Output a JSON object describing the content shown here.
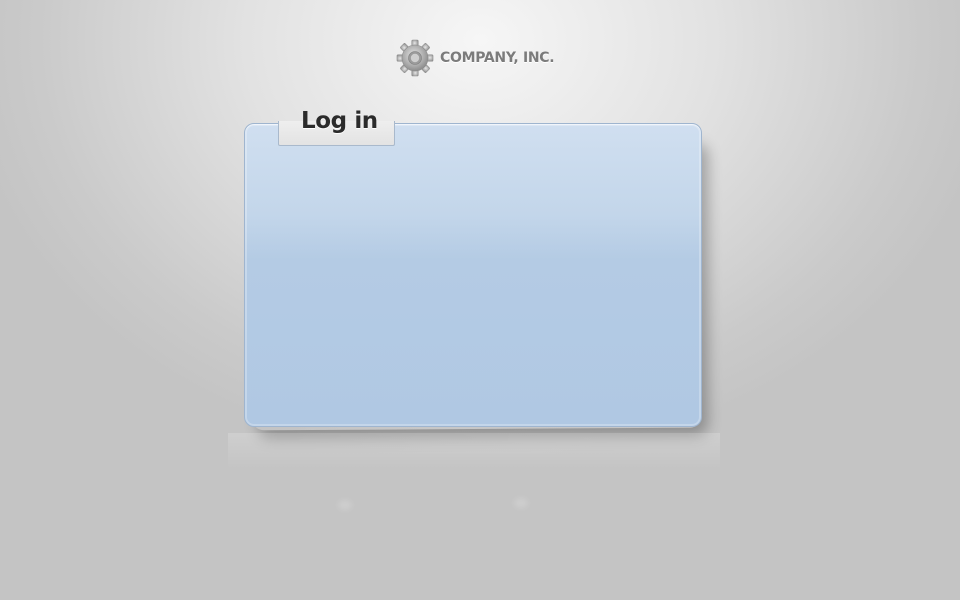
{
  "logo": {
    "text": "COMPANY, INC.",
    "icon": "gear-icon",
    "text_color": "#7b7b7b"
  },
  "login_panel": {
    "title": "Log in",
    "panel_color": "#b4cbe4",
    "tab_color": "#e8e8e8"
  },
  "background_color": "#d0d0d0"
}
